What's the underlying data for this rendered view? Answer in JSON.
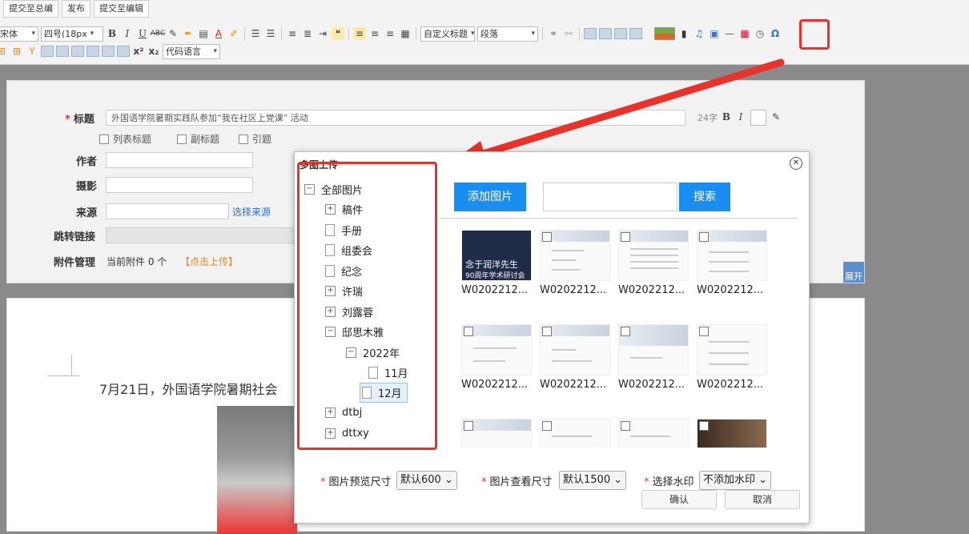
{
  "actions": [
    "提交至总编",
    "发布",
    "提交至编辑"
  ],
  "toolbar": {
    "font_family": "宋体",
    "font_size": "四号(18px",
    "heading_select": "自定义标题",
    "paragraph_select": "段落",
    "code_lang": "代码语言",
    "superscript": "x²",
    "subscript": "x₂",
    "omega": "Ω"
  },
  "form": {
    "title_label": "标题",
    "title_value": "外国语学院暑期实践队参加“我在社区上党课” 活动",
    "title_count": "24字",
    "check_list_title": "列表标题",
    "check_sub_title": "副标题",
    "check_quote": "引题",
    "author_label": "作者",
    "photo_label": "摄影",
    "source_label": "来源",
    "source_link": "选择来源",
    "jump_label": "跳转链接",
    "attach_label": "附件管理",
    "attach_text": "当前附件 0 个",
    "attach_link": "【点击上传】",
    "expand": "展开"
  },
  "doc": {
    "text": "7月21日，外国语学院暑期社会"
  },
  "dialog": {
    "title": "多图上传",
    "add_button": "添加图片",
    "search_button": "搜索",
    "search_value": "",
    "tree": [
      {
        "label": "全部图片",
        "type": "minus"
      },
      {
        "label": "稿件",
        "type": "plus"
      },
      {
        "label": "手册",
        "type": "file"
      },
      {
        "label": "组委会",
        "type": "file"
      },
      {
        "label": "纪念",
        "type": "file"
      },
      {
        "label": "许瑞",
        "type": "plus"
      },
      {
        "label": "刘露蓉",
        "type": "plus"
      },
      {
        "label": "邸思木雅",
        "type": "minus"
      },
      {
        "label": "2022年",
        "type": "minus"
      },
      {
        "label": "11月",
        "type": "file"
      },
      {
        "label": "12月",
        "type": "file"
      },
      {
        "label": "dtbj",
        "type": "plus"
      },
      {
        "label": "dttxy",
        "type": "plus"
      }
    ],
    "thumb_caption": "W0202212...",
    "thumb_dark_text": "念于润洋先生",
    "thumb_dark_sub": "90周年学术研讨会",
    "preview_label": "图片预览尺寸",
    "preview_value": "默认600",
    "view_label": "图片查看尺寸",
    "view_value": "默认1500",
    "watermark_label": "选择水印",
    "watermark_value": "不添加水印",
    "confirm": "确认",
    "cancel": "取消"
  },
  "colors": {
    "accent": "#1a8ef0",
    "highlight": "#e8322a",
    "link": "#2f6fcd",
    "upload_link": "#e58a1c"
  }
}
